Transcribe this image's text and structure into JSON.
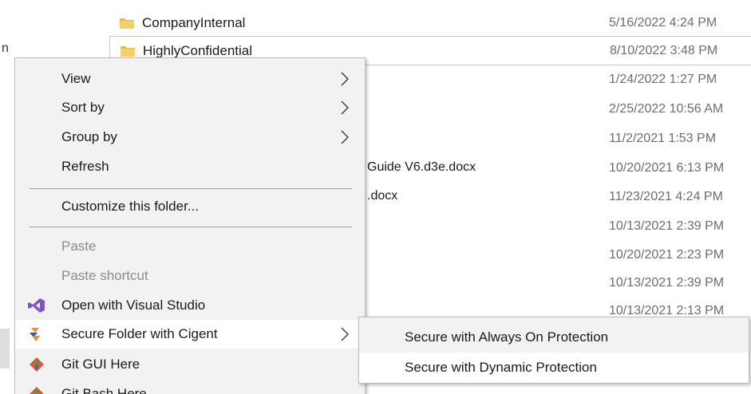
{
  "explorer": {
    "left_fragment": "n",
    "rows": [
      {
        "name": "CompanyInternal",
        "date": "5/16/2022 4:24 PM",
        "folder": true
      },
      {
        "name": "HighlyConfidential",
        "date": "8/10/2022 3:48 PM",
        "folder": true
      },
      {
        "name": "",
        "date": "1/24/2022 1:27 PM"
      },
      {
        "name": "",
        "date": "2/25/2022 10:56 AM"
      },
      {
        "name": "",
        "date": "11/2/2021 1:53 PM"
      },
      {
        "name": "Guide V6.d3e.docx",
        "date": "10/20/2021 6:13 PM"
      },
      {
        "name": ".docx",
        "date": "11/23/2021 4:24 PM"
      },
      {
        "name": "",
        "date": "10/13/2021 2:39 PM"
      },
      {
        "name": "",
        "date": "10/20/2021 2:23 PM"
      },
      {
        "name": "",
        "date": "10/13/2021 2:39 PM"
      },
      {
        "name": "",
        "date": "10/13/2021 2:13 PM"
      }
    ]
  },
  "context_menu": {
    "items": [
      {
        "label": "View",
        "submenu": true
      },
      {
        "label": "Sort by",
        "submenu": true
      },
      {
        "label": "Group by",
        "submenu": true
      },
      {
        "label": "Refresh"
      },
      {
        "label": "Customize this folder..."
      },
      {
        "label": "Paste",
        "disabled": true
      },
      {
        "label": "Paste shortcut",
        "disabled": true
      },
      {
        "label": "Open with Visual Studio",
        "icon": "visual-studio-icon"
      },
      {
        "label": "Secure Folder with Cigent",
        "icon": "cigent-icon",
        "submenu": true
      },
      {
        "label": "Git GUI Here",
        "icon": "git-gui-icon"
      },
      {
        "label": "Git Bash Here",
        "icon": "git-bash-icon"
      }
    ]
  },
  "submenu": {
    "items": [
      {
        "label": "Secure with Always On Protection"
      },
      {
        "label": "Secure with Dynamic Protection"
      }
    ]
  },
  "colors": {
    "menu_bg": "#f2f2f2",
    "hover_bg": "#ffffff",
    "selection_border": "#99d1ff",
    "folder_yellow": "#e8b84a",
    "date_gray": "#6d6d6d",
    "disabled_text": "#8c8c8c"
  }
}
